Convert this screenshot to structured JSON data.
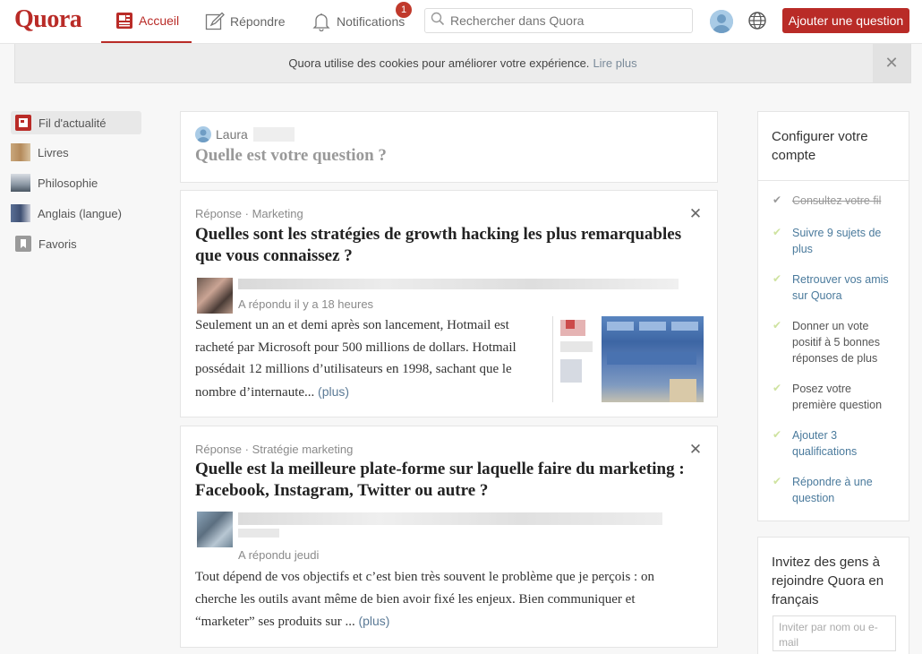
{
  "header": {
    "logo": "Quora",
    "nav": [
      {
        "label": "Accueil",
        "icon": "feed-icon",
        "active": true
      },
      {
        "label": "Répondre",
        "icon": "pencil-icon"
      },
      {
        "label": "Notifications",
        "icon": "bell-icon",
        "badge": "1"
      }
    ],
    "search_placeholder": "Rechercher dans Quora",
    "ask_button": "Ajouter une question",
    "brand_color": "#b92b27"
  },
  "cookie_banner": {
    "text": "Quora utilise des cookies pour améliorer votre expérience.",
    "link": "Lire plus"
  },
  "sidebar": {
    "items": [
      {
        "label": "Fil d'actualité",
        "active": true
      },
      {
        "label": "Livres"
      },
      {
        "label": "Philosophie"
      },
      {
        "label": "Anglais (langue)"
      },
      {
        "label": "Favoris"
      }
    ]
  },
  "ask_box": {
    "user_name": "Laura",
    "prompt": "Quelle est votre question ?"
  },
  "feed": [
    {
      "meta": "Réponse · Marketing",
      "title": "Quelles sont les stratégies de growth hacking les plus remarquables que vous connaissez ?",
      "answered": "A répondu il y a 18 heures",
      "excerpt": "Seulement un an et demi après son lancement, Hotmail est racheté par Microsoft pour 500 millions de dollars. Hotmail possédait 12 millions d’utilisateurs en 1998, sachant que le nombre d’internaute...",
      "more": "(plus)"
    },
    {
      "meta": "Réponse · Stratégie marketing",
      "title": "Quelle est la meilleure plate-forme sur laquelle faire du marketing : Facebook, Instagram, Twitter ou autre ?",
      "answered": "A répondu jeudi",
      "excerpt": "Tout dépend de vos objectifs et c’est bien très souvent le problème que je perçois : on cherche les outils avant même de bien avoir fixé les enjeux. Bien communiquer et “marketer” ses produits sur ...",
      "more": "(plus)"
    }
  ],
  "setup": {
    "title": "Configurer votre compte",
    "steps": [
      {
        "label": "Consultez votre fil",
        "state": "done"
      },
      {
        "label": "Suivre 9 sujets de plus",
        "state": "link"
      },
      {
        "label": "Retrouver vos amis sur Quora",
        "state": "link"
      },
      {
        "label": "Donner un vote positif à 5 bonnes réponses de plus",
        "state": "plain"
      },
      {
        "label": "Posez votre première question",
        "state": "plain"
      },
      {
        "label": "Ajouter 3 qualifications",
        "state": "link"
      },
      {
        "label": "Répondre à une question",
        "state": "link"
      }
    ]
  },
  "invite": {
    "title": "Invitez des gens à rejoindre Quora en français",
    "placeholder": "Inviter par nom ou e-mail"
  }
}
